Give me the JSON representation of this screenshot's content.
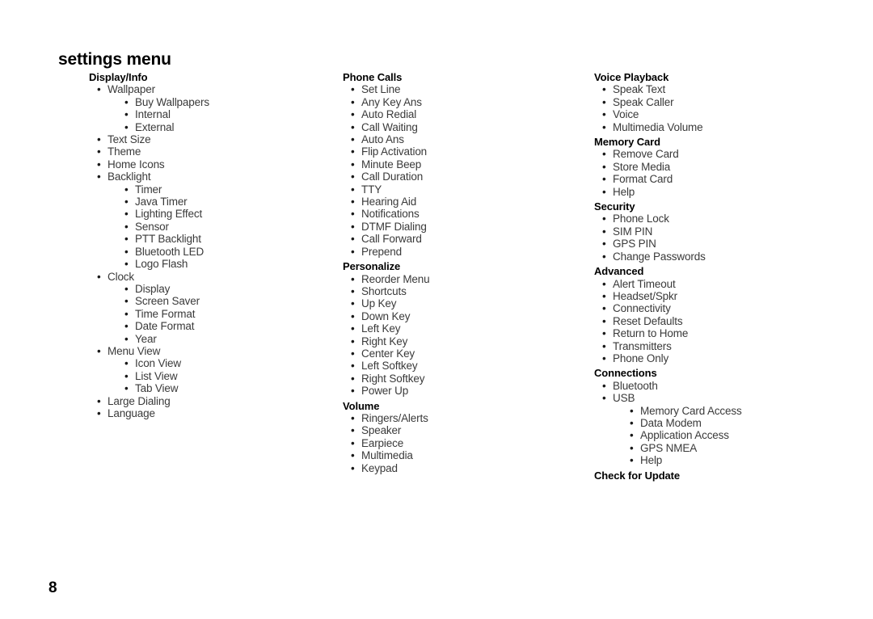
{
  "page": {
    "title": "settings menu",
    "number": "8",
    "bullet_glyph": "•"
  },
  "columns": [
    {
      "name": "column-1",
      "groups": [
        {
          "title": "Display/Info",
          "items": [
            {
              "label": "Wallpaper",
              "level": 1
            },
            {
              "label": "Buy Wallpapers",
              "level": 2
            },
            {
              "label": "Internal",
              "level": 2
            },
            {
              "label": "External",
              "level": 2
            },
            {
              "label": "Text Size",
              "level": 1
            },
            {
              "label": "Theme",
              "level": 1
            },
            {
              "label": "Home Icons",
              "level": 1
            },
            {
              "label": "Backlight",
              "level": 1
            },
            {
              "label": "Timer",
              "level": 2
            },
            {
              "label": "Java Timer",
              "level": 2
            },
            {
              "label": "Lighting Effect",
              "level": 2
            },
            {
              "label": "Sensor",
              "level": 2
            },
            {
              "label": "PTT Backlight",
              "level": 2
            },
            {
              "label": "Bluetooth LED",
              "level": 2
            },
            {
              "label": "Logo Flash",
              "level": 2
            },
            {
              "label": "Clock",
              "level": 1
            },
            {
              "label": "Display",
              "level": 2
            },
            {
              "label": "Screen Saver",
              "level": 2
            },
            {
              "label": "Time Format",
              "level": 2
            },
            {
              "label": "Date Format",
              "level": 2
            },
            {
              "label": "Year",
              "level": 2
            },
            {
              "label": "Menu View",
              "level": 1
            },
            {
              "label": "Icon View",
              "level": 2
            },
            {
              "label": "List View",
              "level": 2
            },
            {
              "label": "Tab View",
              "level": 2
            },
            {
              "label": "Large Dialing",
              "level": 1
            },
            {
              "label": "Language",
              "level": 1
            }
          ]
        }
      ]
    },
    {
      "name": "column-2",
      "groups": [
        {
          "title": "Phone Calls",
          "items": [
            {
              "label": "Set Line",
              "level": 1
            },
            {
              "label": "Any Key Ans",
              "level": 1
            },
            {
              "label": "Auto Redial",
              "level": 1
            },
            {
              "label": "Call Waiting",
              "level": 1
            },
            {
              "label": "Auto Ans",
              "level": 1
            },
            {
              "label": "Flip Activation",
              "level": 1
            },
            {
              "label": "Minute Beep",
              "level": 1
            },
            {
              "label": "Call Duration",
              "level": 1
            },
            {
              "label": "TTY",
              "level": 1
            },
            {
              "label": "Hearing Aid",
              "level": 1
            },
            {
              "label": "Notifications",
              "level": 1
            },
            {
              "label": "DTMF Dialing",
              "level": 1
            },
            {
              "label": "Call Forward",
              "level": 1
            },
            {
              "label": "Prepend",
              "level": 1
            }
          ]
        },
        {
          "title": "Personalize",
          "items": [
            {
              "label": "Reorder Menu",
              "level": 1
            },
            {
              "label": "Shortcuts",
              "level": 1
            },
            {
              "label": "Up Key",
              "level": 1
            },
            {
              "label": "Down Key",
              "level": 1
            },
            {
              "label": "Left Key",
              "level": 1
            },
            {
              "label": "Right Key",
              "level": 1
            },
            {
              "label": "Center Key",
              "level": 1
            },
            {
              "label": "Left Softkey",
              "level": 1
            },
            {
              "label": "Right Softkey",
              "level": 1
            },
            {
              "label": "Power Up",
              "level": 1
            }
          ]
        },
        {
          "title": "Volume",
          "items": [
            {
              "label": "Ringers/Alerts",
              "level": 1
            },
            {
              "label": "Speaker",
              "level": 1
            },
            {
              "label": "Earpiece",
              "level": 1
            },
            {
              "label": "Multimedia",
              "level": 1
            },
            {
              "label": "Keypad",
              "level": 1
            }
          ]
        }
      ]
    },
    {
      "name": "column-3",
      "groups": [
        {
          "title": "Voice Playback",
          "items": [
            {
              "label": "Speak Text",
              "level": 1
            },
            {
              "label": "Speak Caller",
              "level": 1
            },
            {
              "label": "Voice",
              "level": 1
            },
            {
              "label": "Multimedia Volume",
              "level": 1
            }
          ]
        },
        {
          "title": "Memory Card",
          "items": [
            {
              "label": "Remove Card",
              "level": 1
            },
            {
              "label": "Store Media",
              "level": 1
            },
            {
              "label": "Format Card",
              "level": 1
            },
            {
              "label": "Help",
              "level": 1
            }
          ]
        },
        {
          "title": "Security",
          "items": [
            {
              "label": "Phone Lock",
              "level": 1
            },
            {
              "label": "SIM PIN",
              "level": 1
            },
            {
              "label": "GPS PIN",
              "level": 1
            },
            {
              "label": "Change Passwords",
              "level": 1
            }
          ]
        },
        {
          "title": "Advanced",
          "items": [
            {
              "label": "Alert Timeout",
              "level": 1
            },
            {
              "label": "Headset/Spkr",
              "level": 1
            },
            {
              "label": "Connectivity",
              "level": 1
            },
            {
              "label": "Reset Defaults",
              "level": 1
            },
            {
              "label": "Return to Home",
              "level": 1
            },
            {
              "label": "Transmitters",
              "level": 1
            },
            {
              "label": "Phone Only",
              "level": 1
            }
          ]
        },
        {
          "title": "Connections",
          "items": [
            {
              "label": "Bluetooth",
              "level": 1
            },
            {
              "label": "USB",
              "level": 1
            },
            {
              "label": "Memory Card Access",
              "level": 2
            },
            {
              "label": "Data Modem",
              "level": 2
            },
            {
              "label": "Application Access",
              "level": 2
            },
            {
              "label": "GPS NMEA",
              "level": 2
            },
            {
              "label": "Help",
              "level": 2
            }
          ]
        },
        {
          "title": "Check for Update",
          "items": []
        }
      ]
    }
  ]
}
